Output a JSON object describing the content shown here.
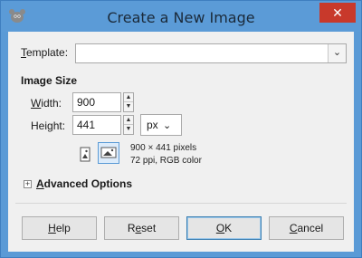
{
  "window": {
    "title": "Create a New Image",
    "close_glyph": "✕"
  },
  "template": {
    "label_ul": "T",
    "label_rest": "emplate:",
    "value": "",
    "arrow": "⌄"
  },
  "image_size": {
    "title": "Image Size",
    "width_label_pre": "",
    "width_label_ul": "W",
    "width_label_rest": "idth:",
    "width_value": "900",
    "height_label_pre": "Hei",
    "height_label_ul": "g",
    "height_label_rest": "ht:",
    "height_value": "441",
    "unit": "px",
    "unit_arrow": "⌄",
    "info_line1": "900 × 441 pixels",
    "info_line2": "72 ppi, RGB color"
  },
  "advanced": {
    "label_ul": "A",
    "label_rest": "dvanced Options"
  },
  "buttons": {
    "help_ul": "H",
    "help_rest": "elp",
    "reset_pre": "R",
    "reset_ul": "e",
    "reset_rest": "set",
    "ok_ul": "O",
    "ok_rest": "K",
    "cancel_ul": "C",
    "cancel_rest": "ancel"
  },
  "icons": [
    "gimp-app-icon",
    "close-icon",
    "chevron-down-icon",
    "portrait-icon",
    "landscape-icon",
    "expander-plus-icon"
  ]
}
